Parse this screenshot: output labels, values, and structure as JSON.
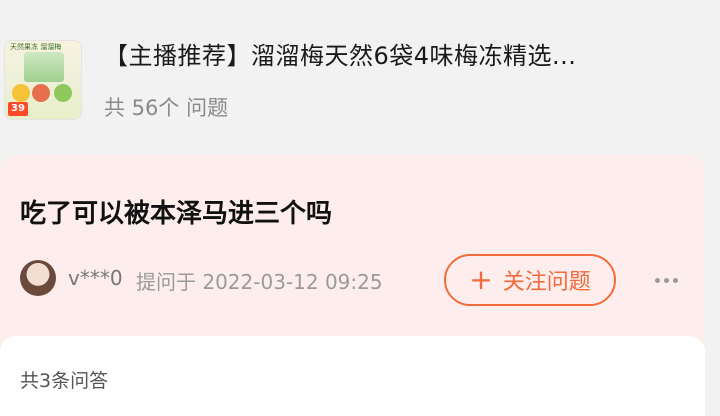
{
  "product": {
    "title": "【主播推荐】溜溜梅天然6袋4味梅冻精选...",
    "question_count": "共 56个 问题",
    "thumbnail_icon": "product-thumbnail",
    "thumbnail_price": "39",
    "thumbnail_brand": "天然果冻 溜溜梅"
  },
  "question": {
    "text": "吃了可以被本泽马进三个吗",
    "user": "v***0",
    "asked_at": "提问于 2022-03-12 09:25",
    "follow_label": "关注问题",
    "follow_plus": "+"
  },
  "answers": {
    "count_label": "共3条问答"
  },
  "colors": {
    "accent": "#f26b3a",
    "card_bg": "#fdeeed",
    "page_bg": "#f2f2f2"
  }
}
